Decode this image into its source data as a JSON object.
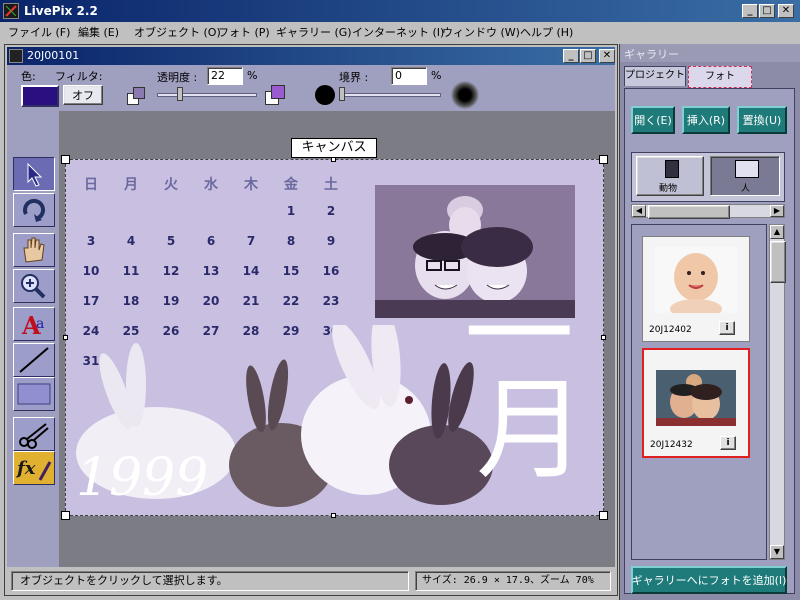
{
  "app": {
    "title": "LivePix 2.2"
  },
  "menu": [
    "ファイル (F)",
    "編集 (E)",
    "オブジェクト (O)",
    "フォト (P)",
    "ギャラリー (G)",
    "インターネット (I)",
    "ウィンドウ (W)",
    "ヘルプ (H)"
  ],
  "document": {
    "title": "20J00101"
  },
  "toolbar": {
    "color_label": "色:",
    "filter_label": "フィルタ:",
    "filter_button": "オフ",
    "transparency_label": "透明度 :",
    "transparency_value": "22",
    "transparency_unit": "%",
    "border_label": "境界 :",
    "border_value": "0",
    "border_unit": "%",
    "color_swatch": "#2a0f80"
  },
  "canvas": {
    "label": "キャンバス",
    "calendar_weekdays": [
      "日",
      "月",
      "火",
      "水",
      "木",
      "金",
      "土"
    ],
    "calendar_rows": [
      [
        "",
        "",
        "",
        "",
        "",
        "1",
        "2"
      ],
      [
        "3",
        "4",
        "5",
        "6",
        "7",
        "8",
        "9"
      ],
      [
        "10",
        "11",
        "12",
        "13",
        "14",
        "15",
        "16"
      ],
      [
        "17",
        "18",
        "19",
        "20",
        "21",
        "22",
        "23"
      ],
      [
        "24",
        "25",
        "26",
        "27",
        "28",
        "29",
        "30"
      ],
      [
        "31",
        "",
        "",
        "",
        "",
        "",
        ""
      ]
    ],
    "year_text": "1999",
    "month_text_1": "一",
    "month_text_2": "月"
  },
  "status": {
    "message": "オブジェクトをクリックして選択します。",
    "size_info": "サイズ: 26.9 × 17.9、ズーム 70%"
  },
  "gallery": {
    "title": "ギャラリー",
    "tabs": [
      "プロジェクト",
      "フォト"
    ],
    "buttons": [
      "開く(E)",
      "挿入(R)",
      "置換(U)"
    ],
    "categories": [
      "動物",
      "人"
    ],
    "thumbnails": [
      {
        "label": "20J12402"
      },
      {
        "label": "20J12432"
      }
    ],
    "add_button": "ギャラリーへにフォトを追加(I)"
  },
  "colors": {
    "workspace": "#7c7c84",
    "panel": "#9f9fbf",
    "canvas_bg": "#c9bfe0",
    "teal": "#1f7a7a"
  }
}
